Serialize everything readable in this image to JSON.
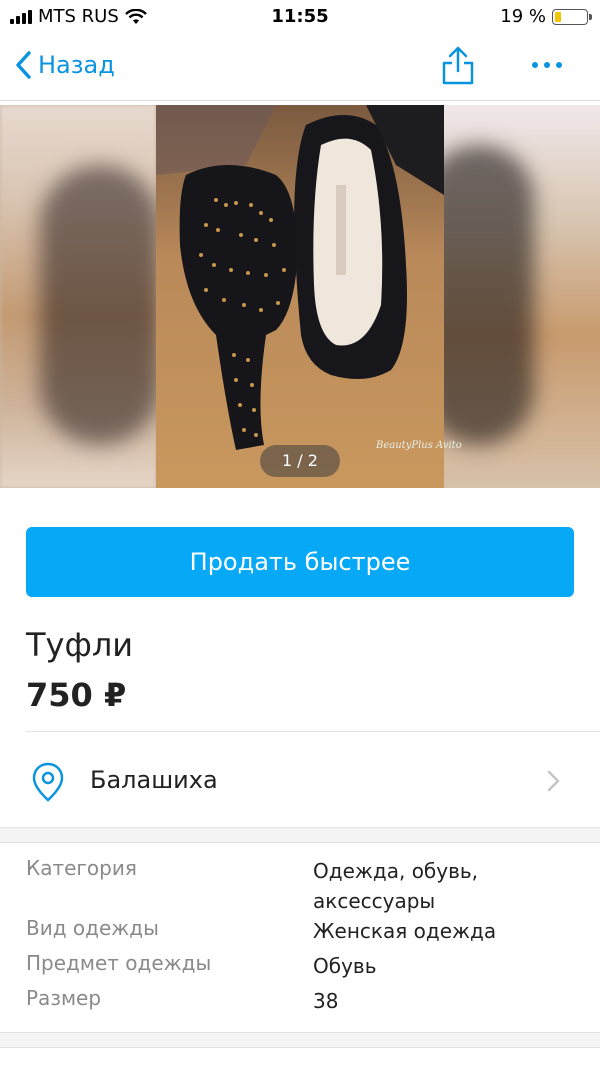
{
  "status_bar": {
    "carrier": "MTS RUS",
    "time": "11:55",
    "battery": "19 %",
    "battery_level": 0.19
  },
  "nav": {
    "back_label": "Назад",
    "share_icon": "share-icon",
    "more_icon": "more-dots-icon"
  },
  "photo": {
    "counter": "1 / 2",
    "watermark": "BeautyPlus Avito"
  },
  "sell_button": "Продать быстрее",
  "listing": {
    "title": "Туфли",
    "price": "750 ₽"
  },
  "location": {
    "city": "Балашиха",
    "icon": "location-pin-icon"
  },
  "params": [
    {
      "key": "Категория",
      "value": "Одежда, обувь, аксессуары"
    },
    {
      "key": "Вид одежды",
      "value": "Женская одежда"
    },
    {
      "key": "Предмет одежды",
      "value": "Обувь"
    },
    {
      "key": "Размер",
      "value": "38"
    }
  ],
  "colors": {
    "accent": "#0a94e0",
    "button": "#07a9f7"
  }
}
